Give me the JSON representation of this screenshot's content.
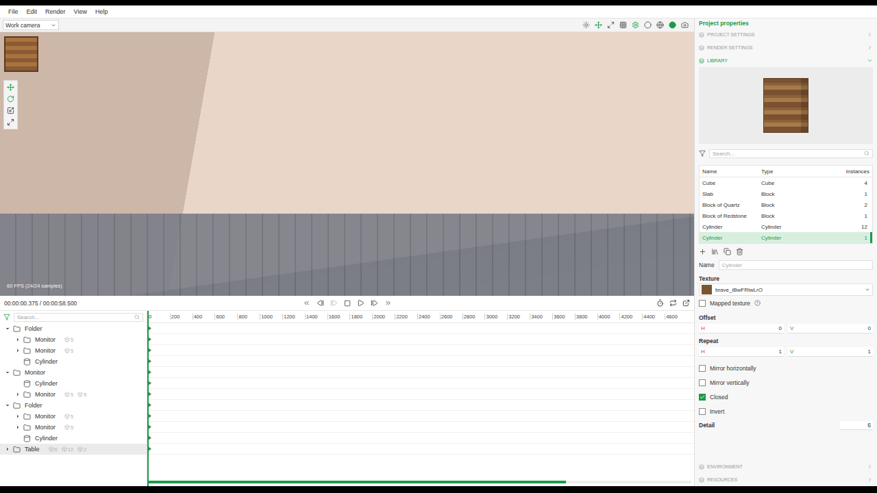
{
  "menu": [
    "File",
    "Edit",
    "Render",
    "View",
    "Help"
  ],
  "viewport": {
    "camera": "Work camera",
    "stats": "60 FPS (24/24 samples)"
  },
  "timeline": {
    "time": "00:00:00.375 / 00:00:58.500",
    "search": {
      "placeholder": "Search..."
    },
    "ticks": [
      "0",
      "200",
      "400",
      "600",
      "800",
      "1000",
      "1200",
      "1400",
      "1600",
      "1800",
      "2000",
      "2200",
      "2400",
      "2600",
      "2800",
      "3000",
      "3200",
      "3400",
      "3600",
      "3800",
      "4000",
      "4200",
      "4400",
      "4600"
    ],
    "playhead_level": 0,
    "scroll_level": 0.77,
    "tree": [
      {
        "label": "Folder",
        "depth": 0,
        "kind": "folder",
        "expanded": true,
        "counts": [],
        "keyframe": true,
        "highlighted": false
      },
      {
        "label": "Monitor",
        "depth": 1,
        "kind": "folder",
        "expanded": false,
        "counts": [
          "5"
        ],
        "keyframe": true,
        "highlighted": false
      },
      {
        "label": "Monitor",
        "depth": 1,
        "kind": "folder",
        "expanded": false,
        "counts": [
          "5"
        ],
        "keyframe": true,
        "highlighted": false
      },
      {
        "label": "Cylinder",
        "depth": 1,
        "kind": "cylinder",
        "expanded": false,
        "counts": [],
        "keyframe": true,
        "highlighted": false
      },
      {
        "label": "Monitor",
        "depth": 0,
        "kind": "folder",
        "expanded": true,
        "counts": [],
        "keyframe": true,
        "highlighted": false
      },
      {
        "label": "Cylinder",
        "depth": 1,
        "kind": "cylinder",
        "expanded": false,
        "counts": [],
        "keyframe": true,
        "highlighted": false
      },
      {
        "label": "Monitor",
        "depth": 1,
        "kind": "folder",
        "expanded": false,
        "counts": [
          "5",
          "5"
        ],
        "keyframe": true,
        "highlighted": false
      },
      {
        "label": "Folder",
        "depth": 0,
        "kind": "folder",
        "expanded": true,
        "counts": [],
        "keyframe": true,
        "highlighted": false
      },
      {
        "label": "Monitor",
        "depth": 1,
        "kind": "folder",
        "expanded": false,
        "counts": [
          "5"
        ],
        "keyframe": true,
        "highlighted": false
      },
      {
        "label": "Monitor",
        "depth": 1,
        "kind": "folder",
        "expanded": false,
        "counts": [
          "5"
        ],
        "keyframe": true,
        "highlighted": false
      },
      {
        "label": "Cylinder",
        "depth": 1,
        "kind": "cylinder",
        "expanded": false,
        "counts": [],
        "keyframe": true,
        "highlighted": false
      },
      {
        "label": "Table",
        "depth": 0,
        "kind": "folder",
        "expanded": false,
        "counts": [
          "6",
          "12",
          "2"
        ],
        "keyframe": true,
        "highlighted": true
      }
    ]
  },
  "panel": {
    "title": "Project properties",
    "sections": [
      {
        "label": "PROJECT SETTINGS",
        "expanded": false
      },
      {
        "label": "RENDER SETTINGS",
        "expanded": false
      },
      {
        "label": "LIBRARY",
        "expanded": true
      }
    ],
    "library": {
      "search": {
        "placeholder": "Search..."
      },
      "columns": [
        "Name",
        "Type",
        "Instances"
      ],
      "rows": [
        {
          "name": "Cube",
          "type": "Cube",
          "instances": "4",
          "selected": false
        },
        {
          "name": "Slab",
          "type": "Block",
          "instances": "1",
          "selected": false
        },
        {
          "name": "Block of Quartz",
          "type": "Block",
          "instances": "2",
          "selected": false
        },
        {
          "name": "Block of Redstone",
          "type": "Block",
          "instances": "1",
          "selected": false
        },
        {
          "name": "Cylinder",
          "type": "Cylinder",
          "instances": "12",
          "selected": false
        },
        {
          "name": "Cylinder",
          "type": "Cylinder",
          "instances": "1",
          "selected": true
        }
      ]
    },
    "name": {
      "label": "Name",
      "placeholder": "Cylinder"
    },
    "texture": {
      "label": "Texture",
      "value": "brave_iBwFRiwLrO"
    },
    "mapped": {
      "label": "Mapped texture",
      "checked": false
    },
    "offset": {
      "label": "Offset",
      "h_label": "H",
      "h": "0",
      "v_label": "V",
      "v": "0"
    },
    "repeat": {
      "label": "Repeat",
      "h_label": "H",
      "h": "1",
      "v_label": "V",
      "v": "1"
    },
    "options": [
      {
        "label": "Mirror horizontally",
        "checked": false
      },
      {
        "label": "Mirror vertically",
        "checked": false
      },
      {
        "label": "Closed",
        "checked": true
      },
      {
        "label": "Invert",
        "checked": false
      }
    ],
    "detail": {
      "label": "Detail",
      "value": "6"
    },
    "footer_sections": [
      {
        "label": "ENVIRONMENT",
        "expanded": false
      },
      {
        "label": "RESOURCES",
        "expanded": false
      }
    ]
  }
}
